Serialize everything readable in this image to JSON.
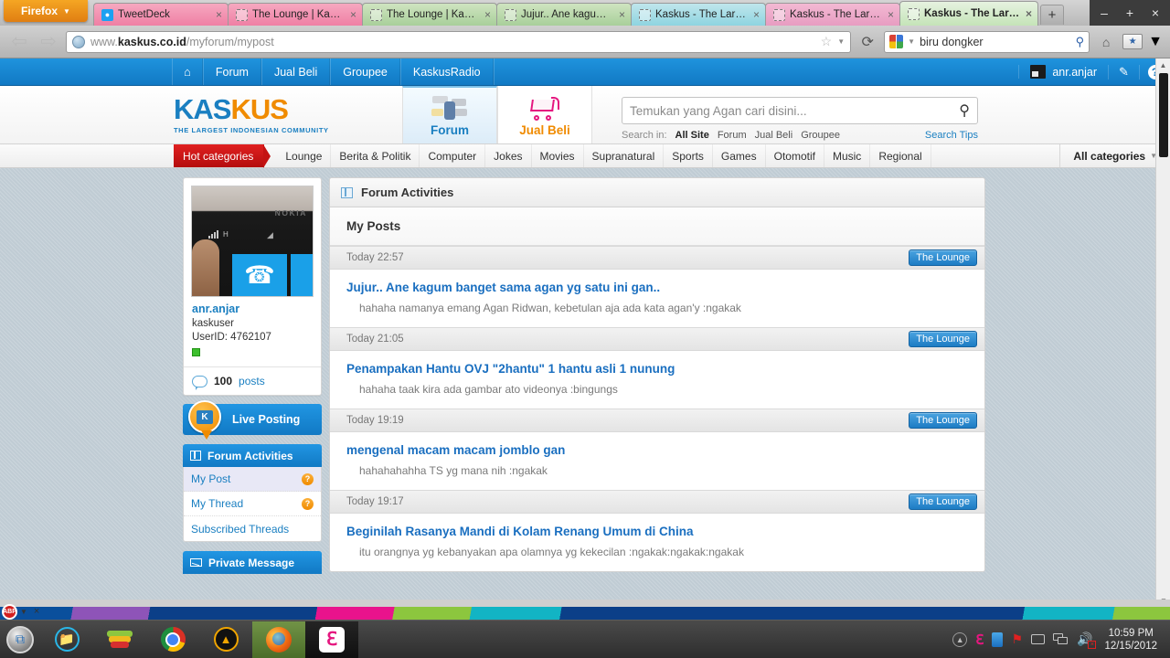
{
  "browser": {
    "app_button": "Firefox",
    "tabs": [
      {
        "title": "TweetDeck",
        "favicon": "twitter-icon",
        "color": "pink",
        "active": false
      },
      {
        "title": "The Lounge | Kasku...",
        "favicon": "page-icon",
        "color": "pink",
        "active": false
      },
      {
        "title": "The Lounge | Kasku...",
        "favicon": "page-icon",
        "color": "green",
        "active": false
      },
      {
        "title": "Jujur.. Ane kagum b...",
        "favicon": "page-icon",
        "color": "green",
        "active": false
      },
      {
        "title": "Kaskus - The Larges...",
        "favicon": "page-icon",
        "color": "cyan",
        "active": false
      },
      {
        "title": "Kaskus - The Larges...",
        "favicon": "page-icon",
        "color": "pink2",
        "active": false
      },
      {
        "title": "Kaskus - The Large...",
        "favicon": "page-icon",
        "color": "green",
        "active": true
      }
    ],
    "new_tab_label": "+",
    "window_controls": {
      "minimize": "–",
      "maximize": "+",
      "close": "×"
    },
    "back_label": "⇦",
    "forward_label": "⇨",
    "url": {
      "prefix": "www.",
      "domain": "kaskus.co.id",
      "path": "/myforum/mypost"
    },
    "reload_label": "⟳",
    "search_engine": "google-icon",
    "search_query": "biru dongker",
    "home_label": "⌂",
    "bookmarks_label": "★"
  },
  "topnav": {
    "home_icon": "home-icon",
    "items": [
      "Forum",
      "Jual Beli",
      "Groupee",
      "KaskusRadio"
    ],
    "username": "anr.anjar",
    "edit_icon": "pencil-icon",
    "help_icon": "question-icon"
  },
  "header": {
    "logo_kas": "KAS",
    "logo_kus": "KUS",
    "logo_tagline": "THE LARGEST INDONESIAN COMMUNITY",
    "tabs": [
      {
        "label": "Forum",
        "icon": "forum-bubbles-icon",
        "active": true
      },
      {
        "label": "Jual Beli",
        "icon": "shopping-cart-icon",
        "active": false
      }
    ],
    "search_placeholder": "Temukan yang Agan cari disini...",
    "search_icon": "search-icon",
    "search_in_label": "Search in:",
    "search_scopes": [
      "All Site",
      "Forum",
      "Jual Beli",
      "Groupee"
    ],
    "search_scope_selected": "All Site",
    "search_tips": "Search Tips"
  },
  "categories": {
    "hot_label": "Hot categories",
    "items": [
      "Lounge",
      "Berita & Politik",
      "Computer",
      "Jokes",
      "Movies",
      "Supranatural",
      "Sports",
      "Games",
      "Otomotif",
      "Music",
      "Regional"
    ],
    "all_label": "All categories"
  },
  "sidebar": {
    "avatar_alt": "user-avatar-nokia-phone",
    "avatar_text": "NOKIA",
    "username": "anr.anjar",
    "usertitle": "kaskuser",
    "userid_label": "UserID: 4762107",
    "status": "online",
    "post_count": "100",
    "post_label": "posts",
    "live_posting": "Live Posting",
    "sections": [
      {
        "title": "Forum Activities",
        "icon": "grid-icon",
        "items": [
          {
            "label": "My Post",
            "badge": "?",
            "active": true
          },
          {
            "label": "My Thread",
            "badge": "?",
            "active": false
          },
          {
            "label": "Subscribed Threads",
            "badge": "",
            "active": false
          }
        ]
      },
      {
        "title": "Private Message",
        "icon": "envelope-icon",
        "items": []
      }
    ]
  },
  "main": {
    "panel_title": "Forum Activities",
    "panel_icon": "grid-icon",
    "section_title": "My Posts",
    "posts": [
      {
        "time": "Today 22:57",
        "forum": "The Lounge",
        "title": "Jujur.. Ane kagum banget sama agan yg satu ini gan..",
        "snippet": "hahaha namanya emang Agan Ridwan, kebetulan aja ada kata agan'y :ngakak"
      },
      {
        "time": "Today 21:05",
        "forum": "The Lounge",
        "title": "Penampakan Hantu OVJ \"2hantu\" 1 hantu asli 1 nunung",
        "snippet": "hahaha taak kira ada gambar ato videonya :bingungs"
      },
      {
        "time": "Today 19:19",
        "forum": "The Lounge",
        "title": "mengenal macam macam jomblo gan",
        "snippet": "hahahahahha TS yg mana nih :ngakak"
      },
      {
        "time": "Today 19:17",
        "forum": "The Lounge",
        "title": "Beginilah Rasanya Mandi di Kolam Renang Umum di China",
        "snippet": "itu orangnya yg kebanyakan apa olamnya yg kekecilan :ngakak:ngakak:ngakak"
      }
    ]
  },
  "addon_bar": {
    "adblock_icon": "adblock-stop-icon",
    "adblock_label": "ABP",
    "close_label": "×"
  },
  "taskbar": {
    "start_icon": "windows-start-icon",
    "apps": [
      {
        "name": "explorer-icon",
        "label": "Windows Explorer",
        "active": false
      },
      {
        "name": "bluestacks-icon",
        "label": "BlueStacks",
        "active": false
      },
      {
        "name": "chrome-icon",
        "label": "Google Chrome",
        "active": false
      },
      {
        "name": "aimp-icon",
        "label": "AIMP",
        "active": false
      },
      {
        "name": "firefox-icon",
        "label": "Mozilla Firefox",
        "active": true
      },
      {
        "name": "camfrog-icon",
        "label": "Camfrog",
        "active": true
      }
    ],
    "tray": [
      "show-hidden-icons",
      "camfrog-tray-icon",
      "blue-tray-icon",
      "red-flag-icon",
      "usb-icon",
      "network-icon",
      "volume-muted-icon"
    ],
    "time": "10:59 PM",
    "date": "12/15/2012"
  },
  "colors": {
    "kaskus_blue": "#1179c4",
    "kaskus_orange": "#f08b00",
    "hot_red": "#c41212",
    "link_blue": "#1a6fc0"
  }
}
